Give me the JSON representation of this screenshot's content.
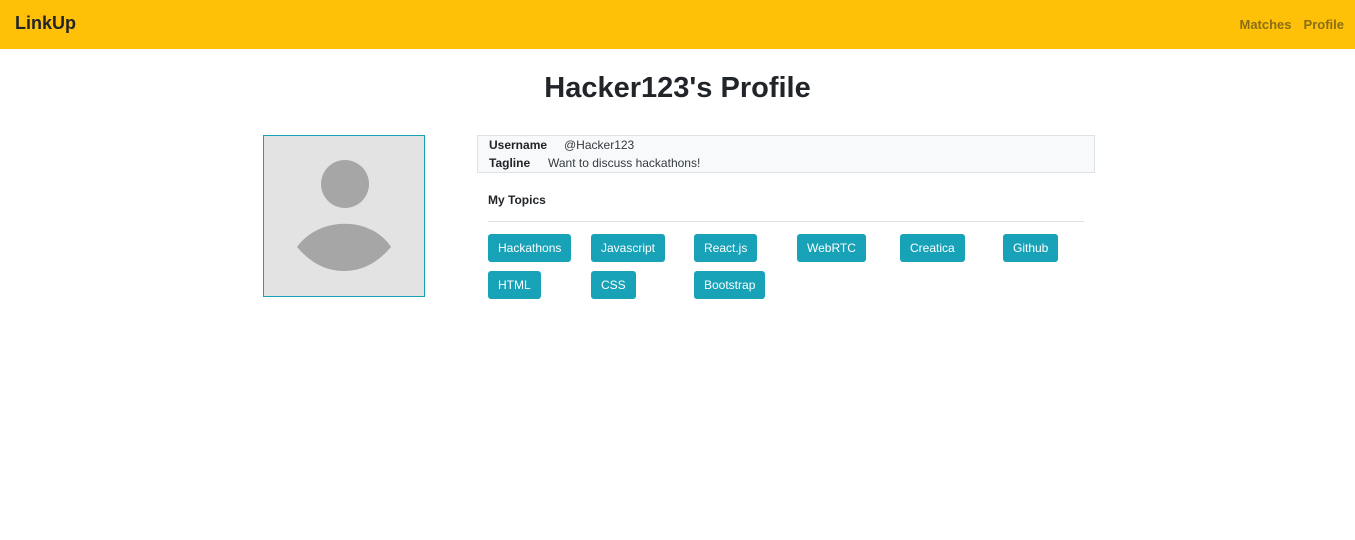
{
  "navbar": {
    "brand": "LinkUp",
    "links": [
      "Matches",
      "Profile"
    ]
  },
  "page_title": "Hacker123's Profile",
  "profile": {
    "username_label": "Username",
    "username_value": "@Hacker123",
    "tagline_label": "Tagline",
    "tagline_value": "Want to discuss hackathons!"
  },
  "topics_header": "My Topics",
  "topics": [
    "Hackathons",
    "Javascript",
    "React.js",
    "WebRTC",
    "Creatica",
    "Github",
    "HTML",
    "CSS",
    "Bootstrap"
  ],
  "colors": {
    "navbar": "#ffc107",
    "accent": "#17a2b8",
    "avatar_bg": "#e3e3e3",
    "avatar_fg": "#a6a6a6"
  }
}
